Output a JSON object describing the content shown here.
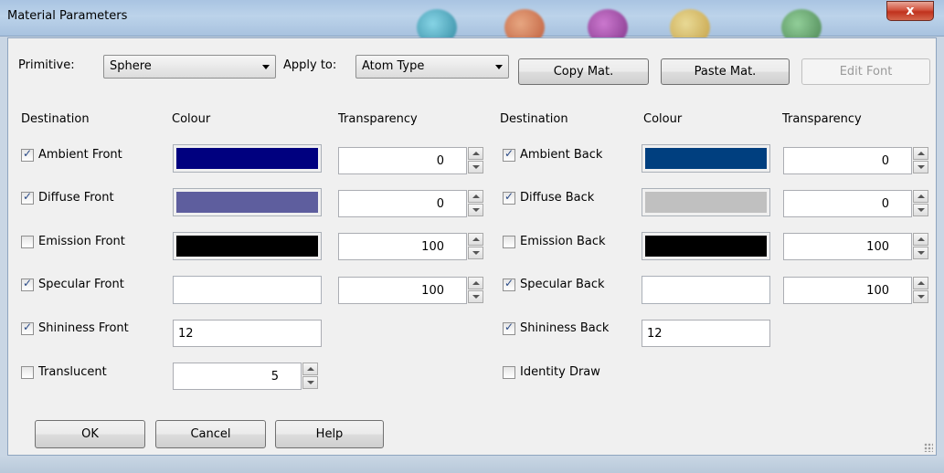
{
  "window": {
    "title": "Material Parameters",
    "close_glyph": "x"
  },
  "toolbar": {
    "primitive_label": "Primitive:",
    "primitive_value": "Sphere",
    "apply_label": "Apply to:",
    "apply_value": "Atom Type",
    "copy_label": "Copy  Mat.",
    "paste_label": "Paste Mat.",
    "edit_font_label": "Edit Font"
  },
  "front": {
    "headers": {
      "destination": "Destination",
      "colour": "Colour",
      "transparency": "Transparency"
    },
    "ambient": {
      "label": "Ambient Front",
      "checked": true,
      "colour": "#00007f",
      "transparency": "0"
    },
    "diffuse": {
      "label": "Diffuse Front",
      "checked": true,
      "colour": "#5e5e9e",
      "transparency": "0"
    },
    "emission": {
      "label": "Emission Front",
      "checked": false,
      "colour": "#000000",
      "transparency": "100"
    },
    "specular": {
      "label": "Specular Front",
      "checked": true,
      "colour": "#ffffff",
      "transparency": "100"
    },
    "shininess": {
      "label": "Shininess Front",
      "checked": true,
      "value": "12"
    },
    "translucent": {
      "label": "Translucent",
      "checked": false,
      "value": "5"
    }
  },
  "back": {
    "headers": {
      "destination": "Destination",
      "colour": "Colour",
      "transparency": "Transparency"
    },
    "ambient": {
      "label": "Ambient Back",
      "checked": true,
      "colour": "#003f7f",
      "transparency": "0"
    },
    "diffuse": {
      "label": "Diffuse Back",
      "checked": true,
      "colour": "#c0c0c0",
      "transparency": "0"
    },
    "emission": {
      "label": "Emission Back",
      "checked": false,
      "colour": "#000000",
      "transparency": "100"
    },
    "specular": {
      "label": "Specular Back",
      "checked": true,
      "colour": "#ffffff",
      "transparency": "100"
    },
    "shininess": {
      "label": "Shininess Back",
      "checked": true,
      "value": "12"
    },
    "identity": {
      "label": "Identity Draw",
      "checked": false
    }
  },
  "buttons": {
    "ok": "OK",
    "cancel": "Cancel",
    "help": "Help"
  }
}
